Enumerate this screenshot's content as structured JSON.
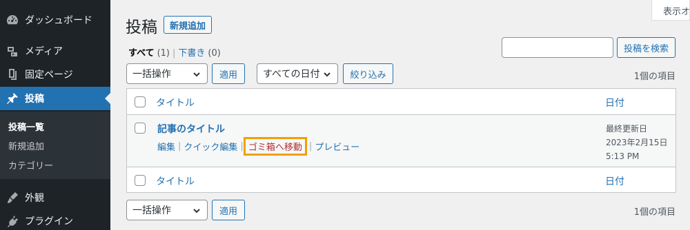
{
  "sidebar": {
    "items": [
      {
        "label": "ダッシュボード",
        "icon": "dashboard-icon"
      },
      {
        "label": "メディア",
        "icon": "media-icon"
      },
      {
        "label": "固定ページ",
        "icon": "page-icon"
      },
      {
        "label": "投稿",
        "icon": "pin-icon",
        "active": true
      },
      {
        "label": "外観",
        "icon": "appearance-icon"
      },
      {
        "label": "プラグイン",
        "icon": "plugin-icon"
      }
    ],
    "submenu": [
      "投稿一覧",
      "新規追加",
      "カテゴリー"
    ]
  },
  "screen_options_label": "表示オ",
  "header": {
    "title": "投稿",
    "add_new_label": "新規追加"
  },
  "views": {
    "all_label": "すべて",
    "all_count": "(1)",
    "separator": "|",
    "drafts_label": "下書き",
    "drafts_count": "(0)"
  },
  "search": {
    "value": "",
    "button_label": "投稿を検索"
  },
  "tablenav_top": {
    "bulk_action": "一括操作",
    "apply_label": "適用",
    "date_filter": "すべての日付",
    "filter_label": "絞り込み",
    "item_count": "1個の項目"
  },
  "table": {
    "col_title": "タイトル",
    "col_date": "日付",
    "rows": [
      {
        "title": "記事のタイトル",
        "actions": {
          "edit": "編集",
          "quick_edit": "クイック編集",
          "trash": "ゴミ箱へ移動",
          "preview": "プレビュー",
          "separator": "|"
        },
        "date_status": "最終更新日",
        "date": "2023年2月15日",
        "time": "5:13 PM"
      }
    ]
  },
  "tablenav_bottom": {
    "bulk_action": "一括操作",
    "apply_label": "適用",
    "item_count": "1個の項目"
  },
  "colors": {
    "accent": "#2271b1",
    "sidebar_bg": "#1d2327",
    "highlight": "#f0a000",
    "trash": "#b32d2e"
  }
}
